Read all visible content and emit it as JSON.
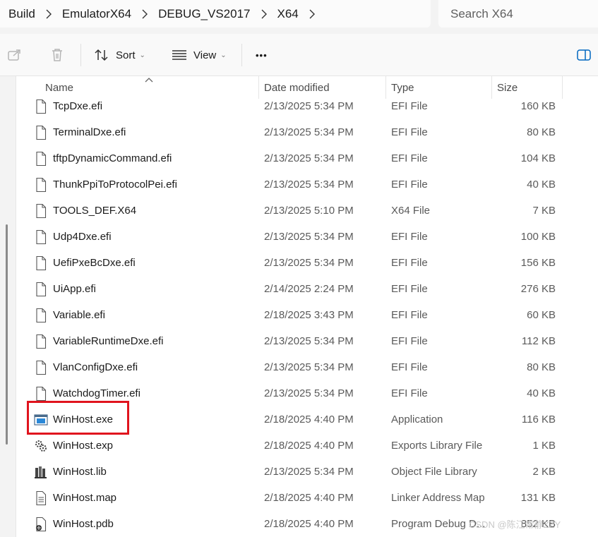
{
  "breadcrumb": [
    "Build",
    "EmulatorX64",
    "DEBUG_VS2017",
    "X64"
  ],
  "search": {
    "placeholder": "Search X64"
  },
  "toolbar": {
    "sort_label": "Sort",
    "view_label": "View",
    "more_label": "•••"
  },
  "columns": {
    "name": "Name",
    "date": "Date modified",
    "type": "Type",
    "size": "Size"
  },
  "files": [
    {
      "name": "TcpDxe.efi",
      "date": "2/13/2025 5:34 PM",
      "type": "EFI File",
      "size": "160 KB",
      "icon": "file-icon"
    },
    {
      "name": "TerminalDxe.efi",
      "date": "2/13/2025 5:34 PM",
      "type": "EFI File",
      "size": "80 KB",
      "icon": "file-icon"
    },
    {
      "name": "tftpDynamicCommand.efi",
      "date": "2/13/2025 5:34 PM",
      "type": "EFI File",
      "size": "104 KB",
      "icon": "file-icon"
    },
    {
      "name": "ThunkPpiToProtocolPei.efi",
      "date": "2/13/2025 5:34 PM",
      "type": "EFI File",
      "size": "40 KB",
      "icon": "file-icon"
    },
    {
      "name": "TOOLS_DEF.X64",
      "date": "2/13/2025 5:10 PM",
      "type": "X64 File",
      "size": "7 KB",
      "icon": "file-icon"
    },
    {
      "name": "Udp4Dxe.efi",
      "date": "2/13/2025 5:34 PM",
      "type": "EFI File",
      "size": "100 KB",
      "icon": "file-icon"
    },
    {
      "name": "UefiPxeBcDxe.efi",
      "date": "2/13/2025 5:34 PM",
      "type": "EFI File",
      "size": "156 KB",
      "icon": "file-icon"
    },
    {
      "name": "UiApp.efi",
      "date": "2/14/2025 2:24 PM",
      "type": "EFI File",
      "size": "276 KB",
      "icon": "file-icon"
    },
    {
      "name": "Variable.efi",
      "date": "2/18/2025 3:43 PM",
      "type": "EFI File",
      "size": "60 KB",
      "icon": "file-icon"
    },
    {
      "name": "VariableRuntimeDxe.efi",
      "date": "2/13/2025 5:34 PM",
      "type": "EFI File",
      "size": "112 KB",
      "icon": "file-icon"
    },
    {
      "name": "VlanConfigDxe.efi",
      "date": "2/13/2025 5:34 PM",
      "type": "EFI File",
      "size": "80 KB",
      "icon": "file-icon"
    },
    {
      "name": "WatchdogTimer.efi",
      "date": "2/13/2025 5:34 PM",
      "type": "EFI File",
      "size": "40 KB",
      "icon": "file-icon"
    },
    {
      "name": "WinHost.exe",
      "date": "2/18/2025 4:40 PM",
      "type": "Application",
      "size": "116 KB",
      "icon": "application-icon"
    },
    {
      "name": "WinHost.exp",
      "date": "2/18/2025 4:40 PM",
      "type": "Exports Library File",
      "size": "1 KB",
      "icon": "exports-library-icon"
    },
    {
      "name": "WinHost.lib",
      "date": "2/13/2025 5:34 PM",
      "type": "Object File Library",
      "size": "2 KB",
      "icon": "library-icon"
    },
    {
      "name": "WinHost.map",
      "date": "2/18/2025 4:40 PM",
      "type": "Linker Address Map",
      "size": "131 KB",
      "icon": "text-file-icon"
    },
    {
      "name": "WinHost.pdb",
      "date": "2/18/2025 4:40 PM",
      "type": "Program Debug D...",
      "size": "852 KB",
      "icon": "debug-database-icon"
    }
  ],
  "watermark": "CSDN @陈江常静ZZY",
  "colors": {
    "highlight_border": "#e0141e",
    "accent_blue": "#0067c0"
  }
}
